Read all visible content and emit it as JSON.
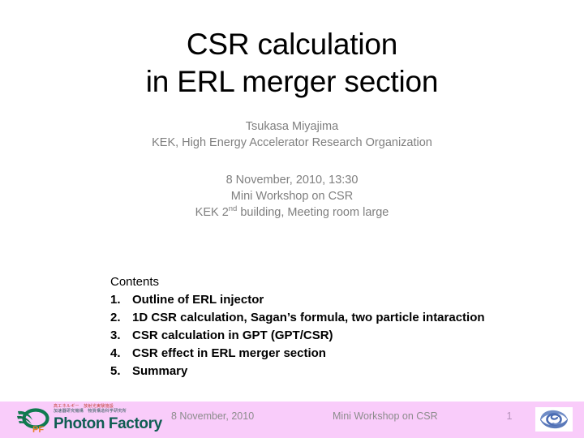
{
  "slide": {
    "title_lines": [
      "CSR calculation",
      "in ERL merger section"
    ],
    "author": {
      "name": "Tsukasa Miyajima",
      "affiliation": "KEK, High Energy Accelerator Research Organization"
    },
    "event": {
      "datetime": "8 November, 2010, 13:30",
      "name": "Mini Workshop on CSR",
      "venue_prefix": "KEK 2",
      "venue_sup": "nd",
      "venue_suffix": " building, Meeting room large"
    },
    "contents": {
      "heading": "Contents",
      "items": [
        {
          "number": "1.",
          "text": "Outline of ERL injector"
        },
        {
          "number": "2.",
          "text": "1D CSR calculation, Sagan’s formula, two particle intaraction"
        },
        {
          "number": "3.",
          "text": "CSR calculation in GPT (GPT/CSR)"
        },
        {
          "number": "4.",
          "text": "CSR effect in ERL merger section"
        },
        {
          "number": "5.",
          "text": "Summary"
        }
      ]
    },
    "footer": {
      "date": "8 November, 2010",
      "event": "Mini Workshop on CSR",
      "page_number": "1",
      "background_color": "#f9ccfa"
    },
    "logos": {
      "pf": {
        "name": "photon-factory-logo",
        "mark_letters": "PF",
        "wordmark": "Photon Factory",
        "jp_line_1": "高エネルギー　放射光実験施設",
        "jp_line_2": "加速器研究機構　物質構造科学研究所",
        "ellipse_color": "#0f7a4f",
        "letters_color": "#e8832a",
        "wordmark_color": "#0f5d52"
      },
      "kek": {
        "name": "kek-logo",
        "swirl_color": "#5f7fc0",
        "background_color": "#ffffff"
      }
    },
    "colors": {
      "title_text": "#000000",
      "subtitle_text": "#7f7f7f",
      "body_text": "#000000",
      "footer_text": "#8c8c8c",
      "slide_background": "#ffffff"
    }
  }
}
